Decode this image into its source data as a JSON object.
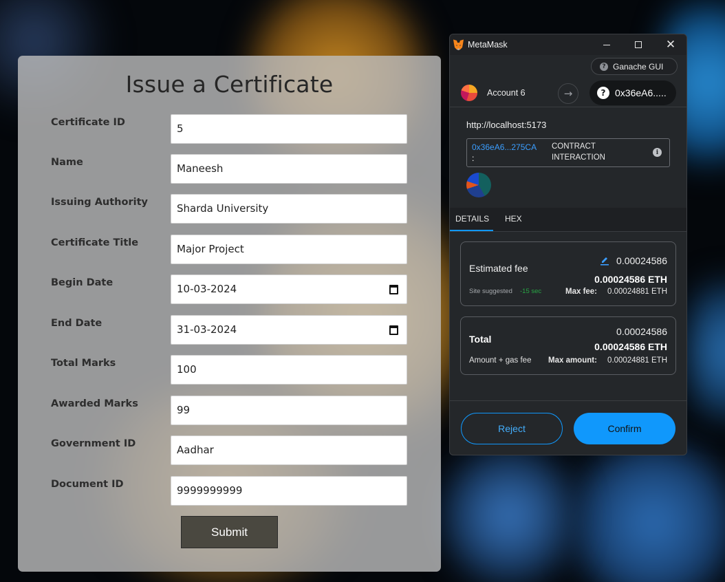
{
  "form": {
    "title": "Issue a Certificate",
    "fields": [
      {
        "label": "Certificate ID",
        "value": "5"
      },
      {
        "label": "Name",
        "value": "Maneesh"
      },
      {
        "label": "Issuing Authority",
        "value": "Sharda University"
      },
      {
        "label": "Certificate Title",
        "value": "Major Project"
      },
      {
        "label": "Begin Date",
        "value": "10-03-2024"
      },
      {
        "label": "End Date",
        "value": "31-03-2024"
      },
      {
        "label": "Total Marks",
        "value": "100"
      },
      {
        "label": "Awarded Marks",
        "value": "99"
      },
      {
        "label": "Government ID",
        "value": "Aadhar"
      },
      {
        "label": "Document ID",
        "value": "9999999999"
      }
    ],
    "submit_label": "Submit"
  },
  "metamask": {
    "window_title": "MetaMask",
    "network": "Ganache GUI",
    "account_name": "Account 6",
    "to_address": "0x36eA6.....",
    "origin": "http://localhost:5173",
    "contract_address": "0x36eA6...275CA",
    "contract_colon": ":",
    "contract_type": "CONTRACT INTERACTION",
    "tabs": [
      "DETAILS",
      "HEX"
    ],
    "estimated_fee": {
      "label": "Estimated fee",
      "amount": "0.00024586",
      "amount_eth": "0.00024586 ETH",
      "site_suggested": "Site suggested",
      "time": "-15 sec",
      "max_fee_label": "Max fee:",
      "max_fee_value": "0.00024881 ETH"
    },
    "total": {
      "label": "Total",
      "amount": "0.00024586",
      "amount_eth": "0.00024586 ETH",
      "sublabel": "Amount + gas fee",
      "max_amount_label": "Max amount:",
      "max_amount_value": "0.00024881 ETH"
    },
    "reject_label": "Reject",
    "confirm_label": "Confirm"
  },
  "colors": {
    "accent": "#1098fc",
    "link": "#3b9eff",
    "positive": "#28a745",
    "card_bg": "#24272a"
  },
  "icons": [
    "fox-icon",
    "minimize-icon",
    "maximize-icon",
    "close-icon",
    "help-icon",
    "arrow-right-icon",
    "info-icon",
    "edit-icon",
    "calendar-icon"
  ]
}
